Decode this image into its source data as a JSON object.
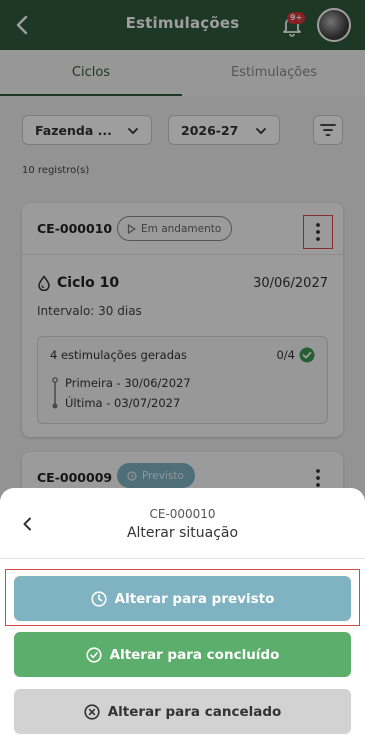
{
  "header": {
    "title": "Estimulações",
    "notification_badge": "9+"
  },
  "tabs": [
    {
      "label": "Ciclos"
    },
    {
      "label": "Estimulações"
    }
  ],
  "filters": {
    "farm": "Fazenda ...",
    "season": "2026-27"
  },
  "records_count": "10 registro(s)",
  "cards": [
    {
      "code": "CE-000010",
      "status": "Em andamento",
      "cycle": "Ciclo 10",
      "date": "30/06/2027",
      "interval": "Intervalo: 30 dias",
      "generated": "4 estimulações geradas",
      "generated_count": "0/4",
      "first": "Primeira - 30/06/2027",
      "last": "Última - 03/07/2027"
    },
    {
      "code": "CE-000009",
      "status": "Previsto"
    }
  ],
  "sheet": {
    "code": "CE-000010",
    "title": "Alterar situação",
    "actions": [
      {
        "label": "Alterar para previsto"
      },
      {
        "label": "Alterar para concluído"
      },
      {
        "label": "Alterar para cancelado"
      }
    ]
  },
  "colors": {
    "header": "#2f5b3a",
    "previsto": "#7fb3c2",
    "concluido": "#5cae6c",
    "cancelado": "#d2d2d2",
    "highlight": "#d94848"
  }
}
